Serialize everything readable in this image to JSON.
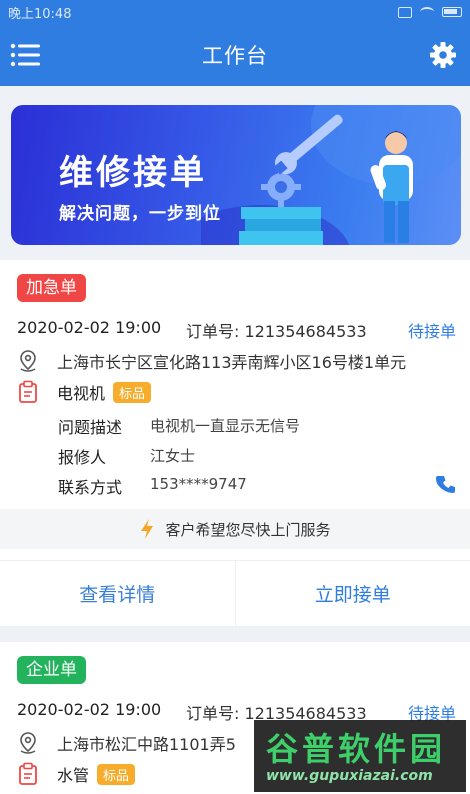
{
  "status_bar": {
    "time": "晚上10:48"
  },
  "app_bar": {
    "title": "工作台"
  },
  "banner": {
    "title": "维修接单",
    "subtitle": "解决问题，一步到位"
  },
  "orders": [
    {
      "tag": "加急单",
      "datetime": "2020-02-02 19:00",
      "order_no": "订单号: 121354684533",
      "status": "待接单",
      "address": "上海市长宁区宣化路113弄南辉小区16号楼1单元",
      "item": "电视机",
      "item_badge": "标品",
      "problem_label": "问题描述",
      "problem_value": "电视机一直显示无信号",
      "reporter_label": "报修人",
      "reporter_value": "江女士",
      "contact_label": "联系方式",
      "contact_value": "153****9747",
      "tip": "客户希望您尽快上门服务",
      "view_detail": "查看详情",
      "accept": "立即接单"
    },
    {
      "tag": "企业单",
      "datetime": "2020-02-02 19:00",
      "order_no": "订单号: 121354684533",
      "status": "待接单",
      "address": "上海市松汇中路1101弄5",
      "item": "水管",
      "item_badge": "标品"
    }
  ],
  "watermark": {
    "name": "谷普软件园",
    "url": "www.gupuxiazai.com"
  },
  "colors": {
    "primary": "#2f7de1",
    "urgent": "#f04646",
    "company": "#22b35c",
    "badge": "#f7ac2b",
    "bolt": "#f5a623"
  }
}
